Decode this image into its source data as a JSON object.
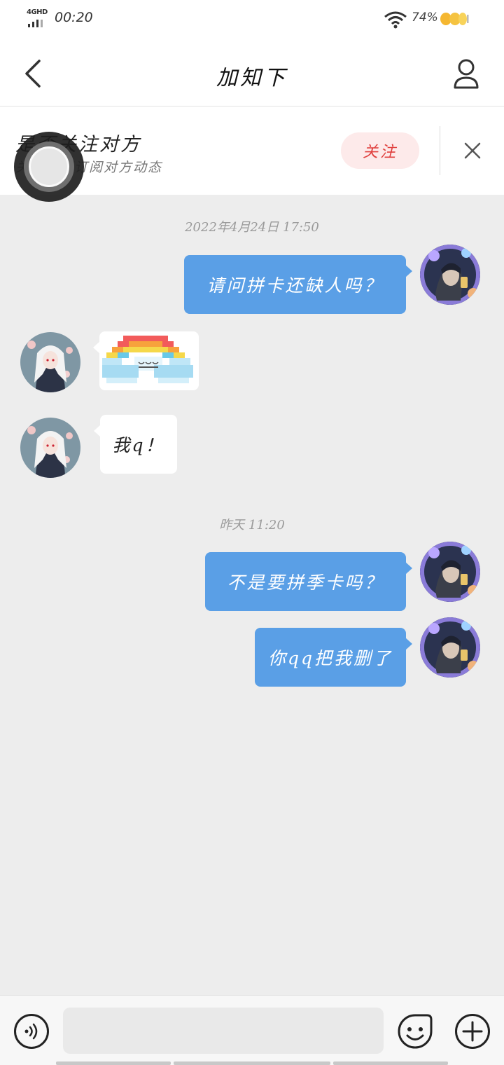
{
  "status_bar": {
    "network": "4GHD",
    "time": "00:20",
    "battery_percent": "74%"
  },
  "header": {
    "title": "加知下",
    "back_icon": "chevron-left-icon",
    "profile_icon": "person-icon"
  },
  "follow_banner": {
    "title": "是否关注对方",
    "subtitle": "关注后可订阅对方动态",
    "follow_label": "关注",
    "close_icon": "close-icon"
  },
  "messages": {
    "timestamp_1": "2022年4月24日 17:50",
    "msg_1": "请问拼卡还缺人吗？",
    "msg_3": "我q！",
    "timestamp_2": "昨天 11:20",
    "msg_4": "不是要拼季卡吗？",
    "msg_5": "你qq把我删了"
  },
  "input_bar": {
    "voice_icon": "voice-icon",
    "emoji_icon": "emoji-icon",
    "plus_icon": "plus-icon",
    "placeholder": ""
  },
  "colors": {
    "outgoing_bubble": "#5a9fe6",
    "follow_button_bg": "#fdeaea",
    "follow_button_text": "#e0403e",
    "chat_background": "#ededed"
  }
}
